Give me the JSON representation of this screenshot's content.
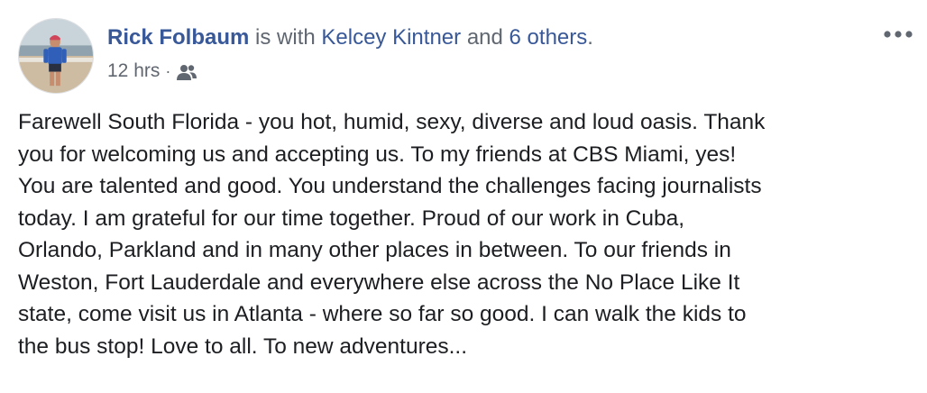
{
  "post": {
    "author": "Rick Folbaum",
    "with_text": "is with",
    "tagged_friend": "Kelcey Kintner",
    "and_text": "and",
    "others_link": "6 others",
    "trailing_period": ".",
    "timestamp": "12 hrs",
    "separator": "·",
    "audience_icon": "friends-icon",
    "more_icon": "more-options-icon",
    "message_lines": [
      "Farewell South Florida - you hot, humid, sexy, diverse and loud oasis. Thank",
      "you for welcoming us and accepting us. To my friends at CBS Miami, yes!",
      "You are talented and good. You understand the challenges facing journalists",
      "today. I am grateful for our time together. Proud of our work in Cuba,",
      "Orlando, Parkland and in many other places in between. To our friends in",
      "Weston, Fort Lauderdale and everywhere else across the No Place Like It",
      "state, come visit us in Atlanta - where so far so good. I can walk the kids to",
      "the bus stop! Love to all. To new adventures..."
    ]
  },
  "colors": {
    "link": "#385898",
    "meta": "#616770",
    "text": "#1c1e21",
    "background": "#ffffff"
  }
}
